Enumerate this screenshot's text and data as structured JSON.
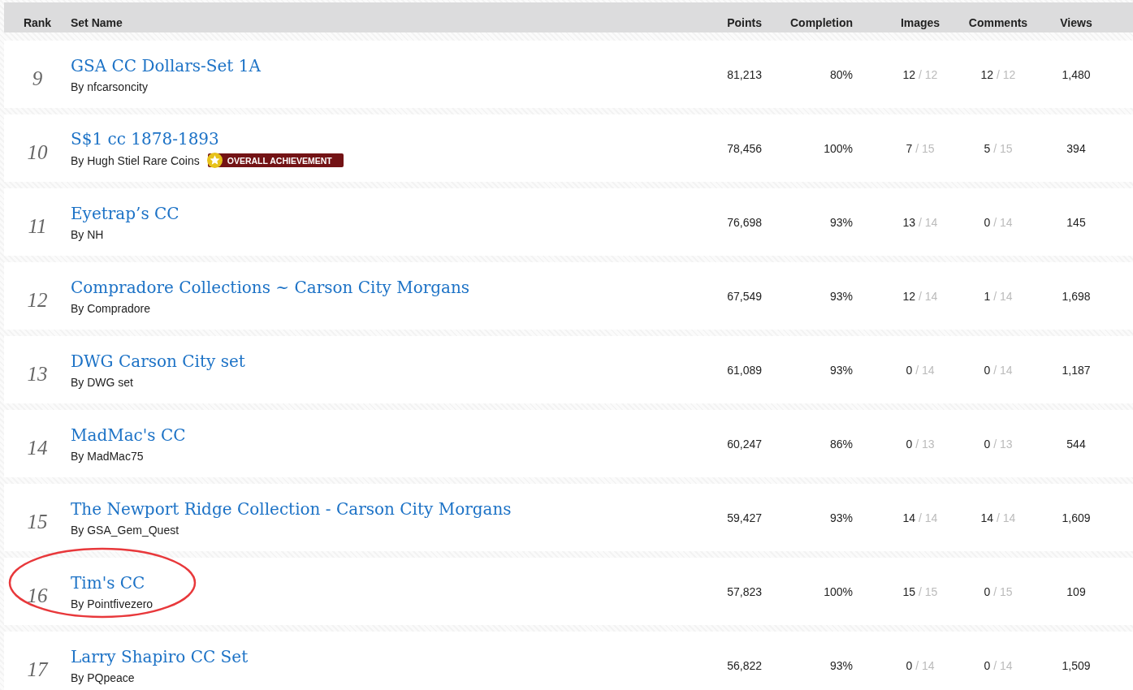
{
  "table": {
    "columns": [
      "Rank",
      "Set Name",
      "Points",
      "Completion",
      "Images",
      "Comments",
      "Views"
    ],
    "rows": [
      {
        "rank": "9",
        "name": "GSA CC Dollars-Set 1A",
        "owner": "By nfcarsoncity",
        "points": "81,213",
        "completion": "80%",
        "images": "12",
        "images_total": "/ 12",
        "comments": "12",
        "comments_total": "/ 12",
        "views": "1,480",
        "circled": false
      },
      {
        "rank": "10",
        "name": "S$1 cc 1878-1893",
        "owner": "By Hugh Stiel Rare Coins",
        "badge": "OVERALL ACHIEVEMENT",
        "points": "78,456",
        "completion": "100%",
        "images": "7",
        "images_total": "/ 15",
        "comments": "5",
        "comments_total": "/ 15",
        "views": "394",
        "circled": false
      },
      {
        "rank": "11",
        "name": "Eyetrap’s CC",
        "owner": "By NH",
        "points": "76,698",
        "completion": "93%",
        "images": "13",
        "images_total": "/ 14",
        "comments": "0",
        "comments_total": "/ 14",
        "views": "145",
        "circled": false
      },
      {
        "rank": "12",
        "name": "Compradore Collections ~ Carson City Morgans",
        "owner": "By Compradore",
        "points": "67,549",
        "completion": "93%",
        "images": "12",
        "images_total": "/ 14",
        "comments": "1",
        "comments_total": "/ 14",
        "views": "1,698",
        "circled": false
      },
      {
        "rank": "13",
        "name": "DWG Carson City set",
        "owner": "By DWG set",
        "points": "61,089",
        "completion": "93%",
        "images": "0",
        "images_total": "/ 14",
        "comments": "0",
        "comments_total": "/ 14",
        "views": "1,187",
        "circled": false
      },
      {
        "rank": "14",
        "name": "MadMac's CC",
        "owner": "By MadMac75",
        "points": "60,247",
        "completion": "86%",
        "images": "0",
        "images_total": "/ 13",
        "comments": "0",
        "comments_total": "/ 13",
        "views": "544",
        "circled": false
      },
      {
        "rank": "15",
        "name": "The Newport Ridge Collection - Carson City Morgans",
        "owner": "By GSA_Gem_Quest",
        "points": "59,427",
        "completion": "93%",
        "images": "14",
        "images_total": "/ 14",
        "comments": "14",
        "comments_total": "/ 14",
        "views": "1,609",
        "circled": false
      },
      {
        "rank": "16",
        "name": "Tim's CC",
        "owner": "By Pointfivezero",
        "points": "57,823",
        "completion": "100%",
        "images": "15",
        "images_total": "/ 15",
        "comments": "0",
        "comments_total": "/ 15",
        "views": "109",
        "circled": true
      },
      {
        "rank": "17",
        "name": "Larry Shapiro CC Set",
        "owner": "By PQpeace",
        "points": "56,822",
        "completion": "93%",
        "images": "0",
        "images_total": "/ 14",
        "comments": "0",
        "comments_total": "/ 14",
        "views": "1,509",
        "circled": false
      }
    ]
  }
}
